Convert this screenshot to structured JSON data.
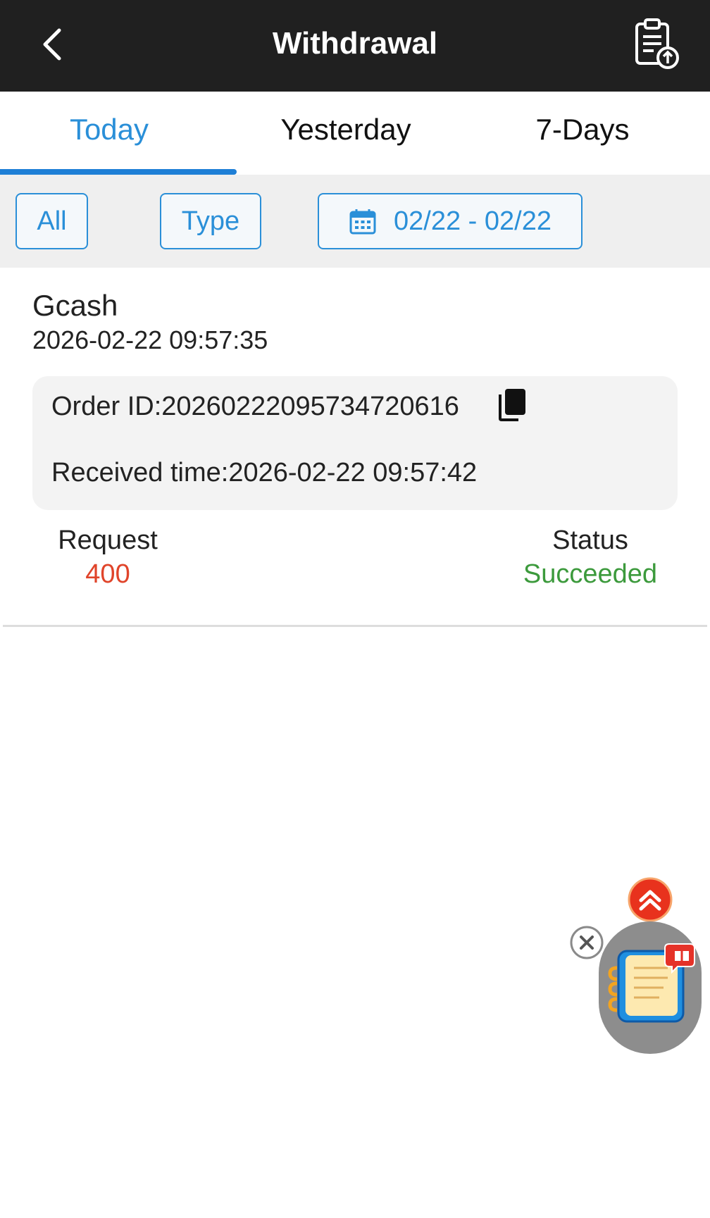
{
  "header": {
    "title": "Withdrawal",
    "back_icon": "chevron-left-icon",
    "report_icon": "clipboard-upload-icon"
  },
  "tabs": [
    {
      "label": "Today",
      "active": true
    },
    {
      "label": "Yesterday",
      "active": false
    },
    {
      "label": "7-Days",
      "active": false
    }
  ],
  "filters": {
    "all_label": "All",
    "type_label": "Type",
    "date_range": "02/22 - 02/22",
    "calendar_icon": "calendar-icon"
  },
  "record": {
    "method": "Gcash",
    "time": "2026-02-22 09:57:35",
    "order_id": "Order ID:20260222095734720616",
    "received_time": "Received time:2026-02-22 09:57:42",
    "request_label": "Request",
    "request_value": "400",
    "status_label": "Status",
    "status_value": "Succeeded"
  },
  "floating": {
    "scroll_top_icon": "double-chevron-up-icon",
    "close_icon": "close-icon",
    "widget_icon": "gift-notebook-icon"
  },
  "colors": {
    "accent": "#2a8fd8",
    "header_bg": "#202020",
    "request_value": "#e0442a",
    "status_success": "#3c9a3c"
  }
}
